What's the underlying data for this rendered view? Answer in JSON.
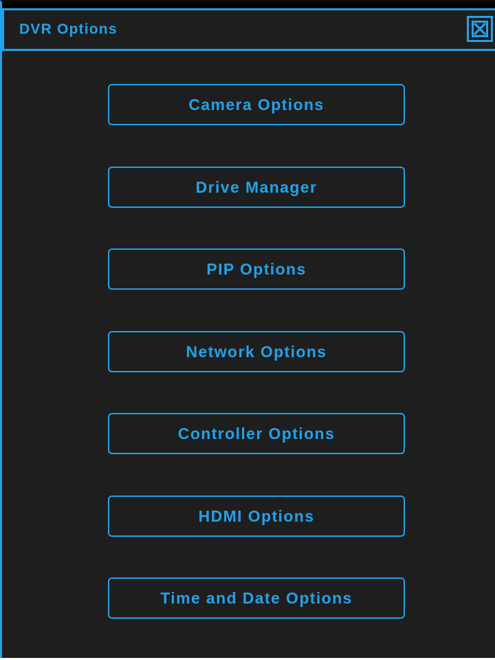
{
  "window": {
    "title": "DVR Options",
    "close_icon": "close-x-box-icon"
  },
  "colors": {
    "accent": "#24a1e8",
    "background": "#1e1e1f",
    "frame_top": "#000000"
  },
  "menu": {
    "items": [
      {
        "label": "Camera Options"
      },
      {
        "label": "Drive Manager"
      },
      {
        "label": "PIP Options"
      },
      {
        "label": "Network Options"
      },
      {
        "label": "Controller Options"
      },
      {
        "label": "HDMI Options"
      },
      {
        "label": "Time and Date Options"
      }
    ]
  }
}
